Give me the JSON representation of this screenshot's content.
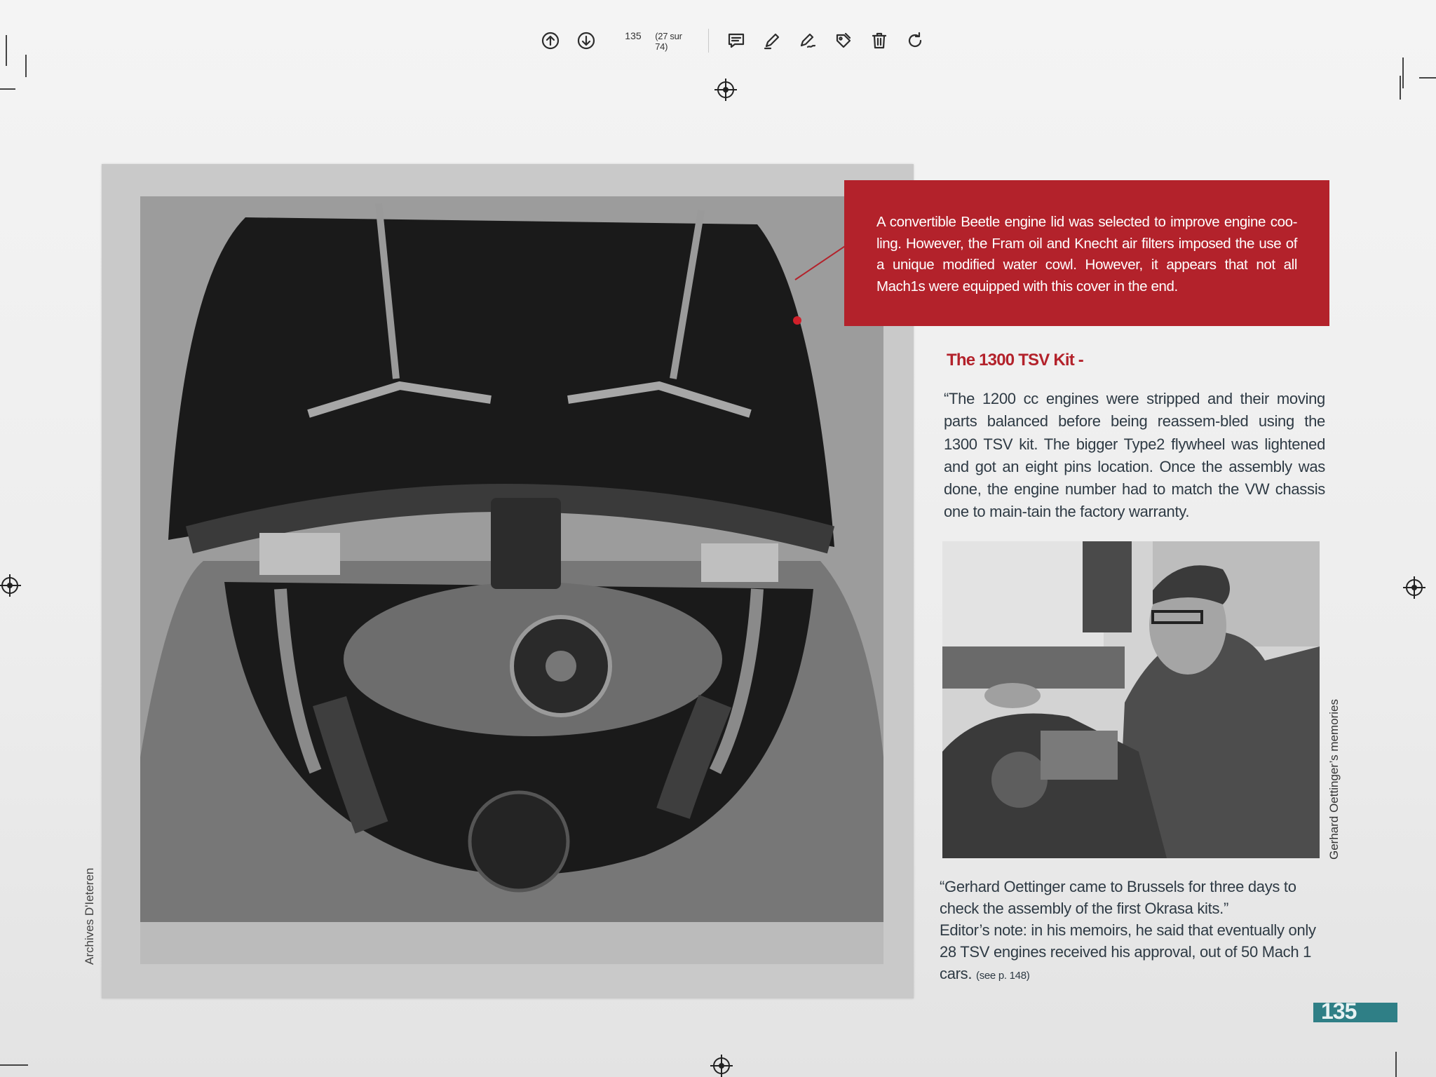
{
  "toolbar": {
    "page_number": "135",
    "page_of": "(27 sur 74)",
    "icons": [
      "arrow-up-circle-icon",
      "arrow-down-circle-icon",
      "comment-icon",
      "pencil-icon",
      "signature-icon",
      "tag-icon",
      "trash-icon",
      "redo-icon"
    ]
  },
  "page": {
    "callout_text": "A convertible Beetle engine lid was selected to improve engine coo-ling. However, the Fram oil and Knecht air filters imposed the use of a unique modified water cowl. However, it appears that not all Mach1s were equipped with this cover in the end.",
    "section_heading": "The 1300 TSV Kit -",
    "body_text": "“The 1200 cc engines were stripped and their moving parts balanced before being reassem-bled using the 1300 TSV kit. The bigger Type2 flywheel was lightened and got an eight pins location. Once the assembly was done, the engine number had to match the VW chassis one to main-tain the factory warranty.",
    "caption_line1": "“Gerhard Oettinger came to Brussels for three days to check the assembly of the first Okrasa kits.”",
    "caption_line2": "Editor’s note: in his memoirs, he said that eventually only 28 TSV engines received his approval, out of 50 Mach 1 cars.",
    "caption_ref": "(see p. 148)",
    "credit_left": "Archives D'Ieteren",
    "credit_right": "Gerhard Oettinger’s memories",
    "page_badge": "135"
  },
  "colors": {
    "accent_red": "#b3222b",
    "badge_teal": "#2f7f86",
    "body_text": "#2e3a44"
  }
}
